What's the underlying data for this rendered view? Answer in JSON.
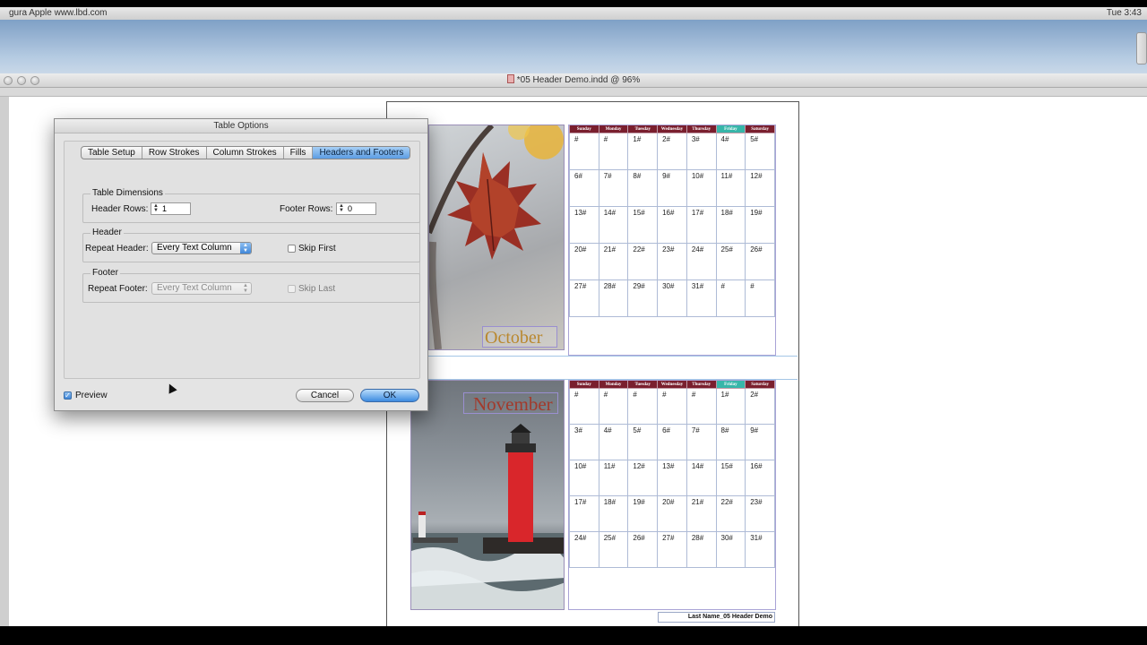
{
  "menubar": {
    "left_text": "gura Apple  www.lbd.com",
    "right_text": "Tue 3:43"
  },
  "window": {
    "title": "*05 Header Demo.indd @ 96%"
  },
  "dialog": {
    "title": "Table Options",
    "tabs": [
      {
        "label": "Table Setup",
        "active": false
      },
      {
        "label": "Row Strokes",
        "active": false
      },
      {
        "label": "Column Strokes",
        "active": false
      },
      {
        "label": "Fills",
        "active": false
      },
      {
        "label": "Headers and Footers",
        "active": true
      }
    ],
    "table_dimensions": {
      "group_label": "Table Dimensions",
      "header_rows_label": "Header Rows:",
      "header_rows_value": "1",
      "footer_rows_label": "Footer Rows:",
      "footer_rows_value": "0"
    },
    "header": {
      "group_label": "Header",
      "repeat_label": "Repeat Header:",
      "repeat_value": "Every Text Column",
      "skip_label": "Skip First",
      "skip_checked": false
    },
    "footer": {
      "group_label": "Footer",
      "repeat_label": "Repeat Footer:",
      "repeat_value": "Every Text Column",
      "skip_label": "Skip Last",
      "skip_checked": false,
      "disabled": true
    },
    "preview_label": "Preview",
    "preview_checked": true,
    "cancel_label": "Cancel",
    "ok_label": "OK"
  },
  "calendar": {
    "days": [
      "Sunday",
      "Monday",
      "Tuesday",
      "Wednesday",
      "Thursday",
      "Friday",
      "Saturday"
    ],
    "highlight_day": "Friday",
    "october": {
      "label": "October",
      "weeks": [
        [
          "#",
          "#",
          "1#",
          "2#",
          "3#",
          "4#",
          "5#"
        ],
        [
          "6#",
          "7#",
          "8#",
          "9#",
          "10#",
          "11#",
          "12#"
        ],
        [
          "13#",
          "14#",
          "15#",
          "16#",
          "17#",
          "18#",
          "19#"
        ],
        [
          "20#",
          "21#",
          "22#",
          "23#",
          "24#",
          "25#",
          "26#"
        ],
        [
          "27#",
          "28#",
          "29#",
          "30#",
          "31#",
          "#",
          "#"
        ]
      ]
    },
    "november": {
      "label": "November",
      "weeks": [
        [
          "#",
          "#",
          "#",
          "#",
          "#",
          "1#",
          "2#"
        ],
        [
          "3#",
          "4#",
          "5#",
          "6#",
          "7#",
          "8#",
          "9#"
        ],
        [
          "10#",
          "11#",
          "12#",
          "13#",
          "14#",
          "15#",
          "16#"
        ],
        [
          "17#",
          "18#",
          "19#",
          "20#",
          "21#",
          "22#",
          "23#"
        ],
        [
          "24#",
          "25#",
          "26#",
          "27#",
          "28#",
          "30#",
          "31#"
        ]
      ]
    }
  },
  "footer_slug": "Last Name_05 Header Demo",
  "colors": {
    "header_bg": "#7a1f2e",
    "highlight": "#37b6a9",
    "accent_blue": "#3d8be0"
  }
}
